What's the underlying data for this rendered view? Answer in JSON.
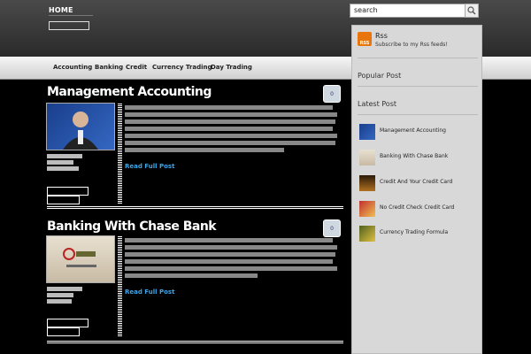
{
  "header": {
    "home_label": "HOME"
  },
  "search": {
    "value": "search"
  },
  "nav": {
    "items": [
      "Accounting",
      "Banking",
      "Credit",
      "Currency Trading",
      "Day Trading"
    ]
  },
  "sidebar": {
    "rss_title": "Rss",
    "rss_subtitle": "Subscribe to my Rss feeds!",
    "rss_icon_text": "RSS",
    "popular_heading": "Popular Post",
    "latest_heading": "Latest Post",
    "latest_items": [
      "Management Accounting",
      "Banking With Chase Bank",
      "Credit And Your Credit Card",
      "No Credit Check Credit Card",
      "Currency Trading Formula"
    ]
  },
  "posts": [
    {
      "title": "Management Accounting",
      "comments": "0",
      "read_more": "Read Full Post"
    },
    {
      "title": "Banking With Chase Bank",
      "comments": "0",
      "read_more": "Read Full Post"
    }
  ],
  "colors": {
    "accent_link": "#3aa5e8",
    "rss_orange": "#e8760c"
  }
}
